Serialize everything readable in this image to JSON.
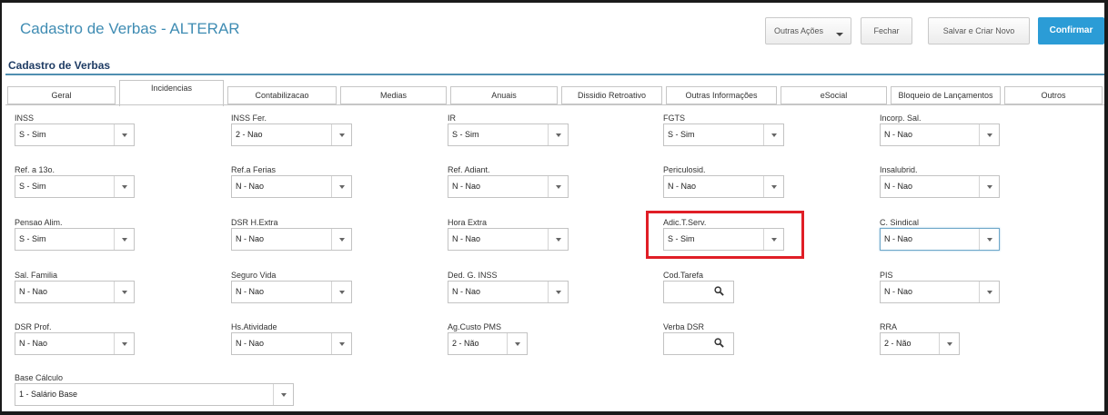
{
  "header": {
    "title": "Cadastro de Verbas - ALTERAR",
    "buttons": {
      "outras_acoes": "Outras Ações",
      "fechar": "Fechar",
      "salvar_criar_novo": "Salvar e Criar Novo",
      "confirmar": "Confirmar"
    }
  },
  "section": {
    "title": "Cadastro de Verbas"
  },
  "tabs": [
    {
      "label": "Geral"
    },
    {
      "label": "Incidencias",
      "active": true
    },
    {
      "label": "Contabilizacao"
    },
    {
      "label": "Medias"
    },
    {
      "label": "Anuais"
    },
    {
      "label": "Dissidio Retroativo"
    },
    {
      "label": "Outras Informações"
    },
    {
      "label": "eSocial"
    },
    {
      "label": "Bloqueio de Lançamentos"
    },
    {
      "label": "Outros"
    }
  ],
  "fields": {
    "inss": {
      "label": "INSS",
      "value": "S - Sim"
    },
    "inss_fer": {
      "label": "INSS Fer.",
      "value": "2 - Nao"
    },
    "ir": {
      "label": "IR",
      "value": "S - Sim"
    },
    "fgts": {
      "label": "FGTS",
      "value": "S - Sim"
    },
    "incorp_sal": {
      "label": "Incorp. Sal.",
      "value": "N - Nao"
    },
    "ref_13o": {
      "label": "Ref. a 13o.",
      "value": "S - Sim"
    },
    "ref_ferias": {
      "label": "Ref.a Ferias",
      "value": "N - Nao"
    },
    "ref_adiant": {
      "label": "Ref. Adiant.",
      "value": "N - Nao"
    },
    "periculosid": {
      "label": "Periculosid.",
      "value": "N - Nao"
    },
    "insalubrid": {
      "label": "Insalubrid.",
      "value": "N - Nao"
    },
    "pensao_alim": {
      "label": "Pensao Alim.",
      "value": "S - Sim"
    },
    "dsr_hextra": {
      "label": "DSR H.Extra",
      "value": "N - Nao"
    },
    "hora_extra": {
      "label": "Hora Extra",
      "value": "N - Nao"
    },
    "adic_tserv": {
      "label": "Adic.T.Serv.",
      "value": "S - Sim"
    },
    "c_sindical": {
      "label": "C. Sindical",
      "value": "N - Nao"
    },
    "sal_familia": {
      "label": "Sal. Familia",
      "value": "N - Nao"
    },
    "seguro_vida": {
      "label": "Seguro Vida",
      "value": "N - Nao"
    },
    "ded_g_inss": {
      "label": "Ded. G. INSS",
      "value": "N - Nao"
    },
    "cod_tarefa": {
      "label": "Cod.Tarefa",
      "value": ""
    },
    "pis": {
      "label": "PIS",
      "value": "N - Nao"
    },
    "dsr_prof": {
      "label": "DSR Prof.",
      "value": "N - Nao"
    },
    "hs_atividade": {
      "label": "Hs.Atividade",
      "value": "N - Nao"
    },
    "ag_custo_pms": {
      "label": "Ag.Custo PMS",
      "value": "2 - Não"
    },
    "verba_dsr": {
      "label": "Verba DSR",
      "value": ""
    },
    "rra": {
      "label": "RRA",
      "value": "2 - Não"
    },
    "base_calculo": {
      "label": "Base Cálculo",
      "value": "1 - Salário Base"
    }
  },
  "colors": {
    "accent": "#2b9cd6",
    "title": "#3f8cb3",
    "highlight": "#e01e26"
  },
  "icons": {
    "lookup": "search-icon",
    "dropdown": "chevron-down-icon"
  }
}
